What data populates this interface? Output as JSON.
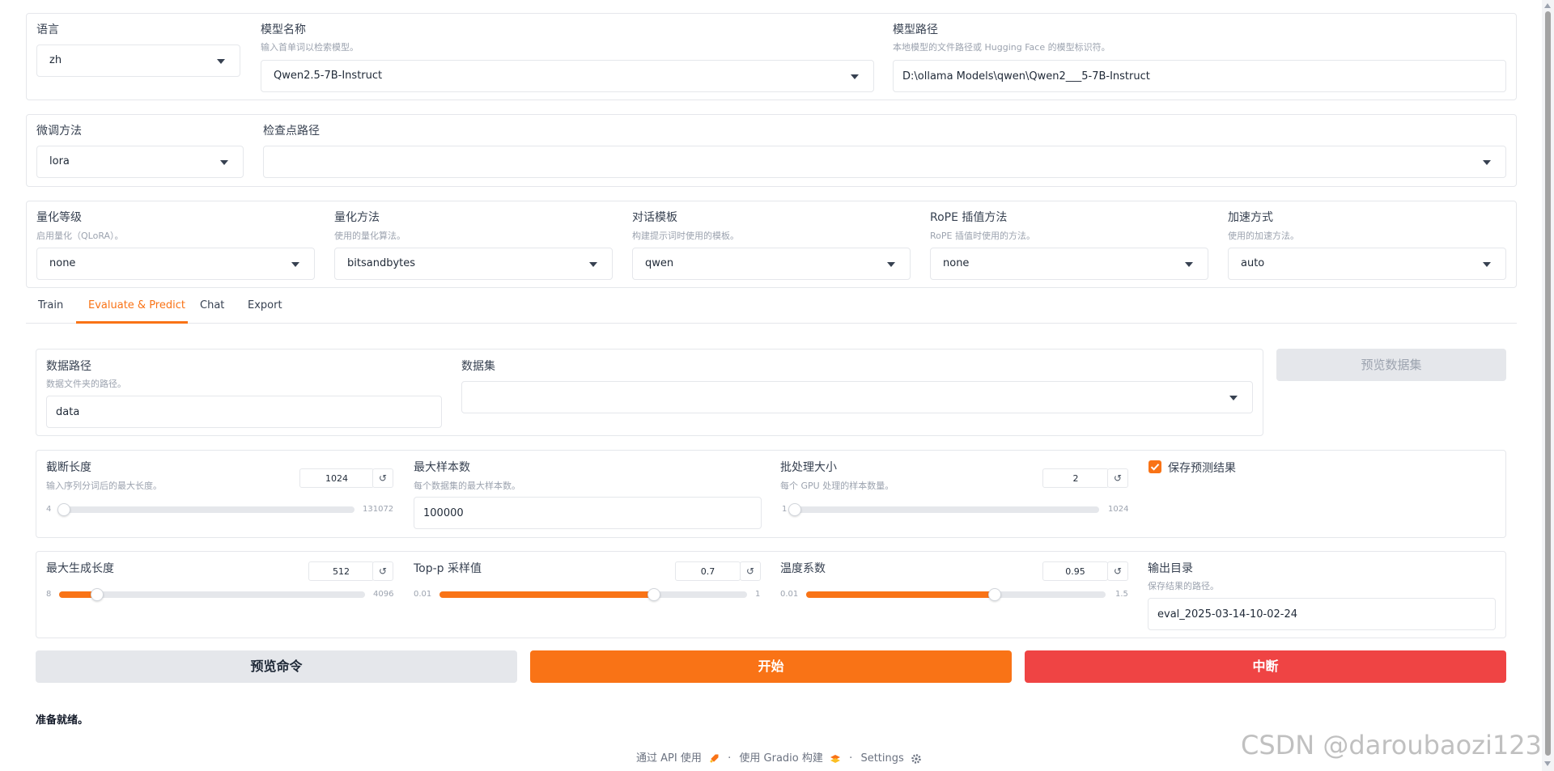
{
  "row1": {
    "lang": {
      "label": "语言",
      "value": "zh"
    },
    "model_name": {
      "label": "模型名称",
      "info": "输入首单词以检索模型。",
      "value": "Qwen2.5-7B-Instruct"
    },
    "model_path": {
      "label": "模型路径",
      "info": "本地模型的文件路径或 Hugging Face 的模型标识符。",
      "value": "D:\\ollama Models\\qwen\\Qwen2___5-7B-Instruct"
    }
  },
  "row2": {
    "finetune": {
      "label": "微调方法",
      "value": "lora"
    },
    "checkpoint": {
      "label": "检查点路径",
      "value": ""
    }
  },
  "row3": {
    "quant_bit": {
      "label": "量化等级",
      "info": "启用量化（QLoRA）。",
      "value": "none"
    },
    "quant_method": {
      "label": "量化方法",
      "info": "使用的量化算法。",
      "value": "bitsandbytes"
    },
    "template": {
      "label": "对话模板",
      "info": "构建提示词时使用的模板。",
      "value": "qwen"
    },
    "rope": {
      "label": "RoPE 插值方法",
      "info": "RoPE 插值时使用的方法。",
      "value": "none"
    },
    "booster": {
      "label": "加速方式",
      "info": "使用的加速方法。",
      "value": "auto"
    }
  },
  "tabs": [
    "Train",
    "Evaluate & Predict",
    "Chat",
    "Export"
  ],
  "active_tab": 1,
  "data": {
    "dir": {
      "label": "数据路径",
      "info": "数据文件夹的路径。",
      "value": "data"
    },
    "dataset": {
      "label": "数据集",
      "value": ""
    },
    "preview_label": "预览数据集"
  },
  "params1": {
    "cutoff": {
      "label": "截断长度",
      "info": "输入序列分词后的最大长度。",
      "value": 1024,
      "min": 4,
      "max": 131072,
      "min_label": "4",
      "max_label": "131072",
      "value_text": "1024"
    },
    "max_samples": {
      "label": "最大样本数",
      "info": "每个数据集的最大样本数。",
      "value": "100000"
    },
    "batch": {
      "label": "批处理大小",
      "info": "每个 GPU 处理的样本数量。",
      "value": 2,
      "min": 1,
      "max": 1024,
      "min_label": "1",
      "max_label": "1024",
      "value_text": "2"
    },
    "predict": {
      "label": "保存预测结果",
      "checked": true
    }
  },
  "params2": {
    "max_new": {
      "label": "最大生成长度",
      "value": 512,
      "min": 8,
      "max": 4096,
      "min_label": "8",
      "max_label": "4096",
      "value_text": "512"
    },
    "top_p": {
      "label": "Top-p 采样值",
      "value": 0.7,
      "min": 0.01,
      "max": 1,
      "min_label": "0.01",
      "max_label": "1",
      "value_text": "0.7"
    },
    "temp": {
      "label": "温度系数",
      "value": 0.95,
      "min": 0.01,
      "max": 1.5,
      "min_label": "0.01",
      "max_label": "1.5",
      "value_text": "0.95"
    },
    "output": {
      "label": "输出目录",
      "info": "保存结果的路径。",
      "value": "eval_2025-03-14-10-02-24"
    }
  },
  "buttons": {
    "preview_cmd": "预览命令",
    "start": "开始",
    "abort": "中断"
  },
  "status": "准备就绪。",
  "footer": {
    "api": "通过 API 使用",
    "sep": "·",
    "built": "使用 Gradio 构建",
    "settings": "Settings"
  },
  "watermark": "CSDN @daroubaozi123",
  "colors": {
    "accent": "#f97316",
    "abort": "#ef4444",
    "secondary": "#e5e7eb"
  },
  "reset_glyph": "↺",
  "icons": {
    "caret": "chevron-down-icon",
    "reset": "reset-icon",
    "check": "check-icon",
    "rocket": "rocket-icon",
    "gradio": "gradio-logo-icon",
    "gear": "gear-icon"
  }
}
